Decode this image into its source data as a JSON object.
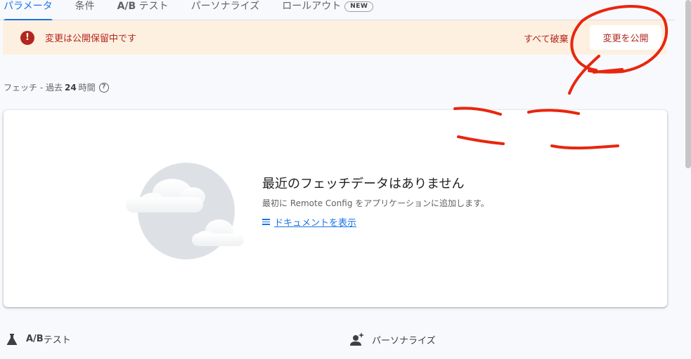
{
  "tabs": [
    {
      "label": "パラメータ"
    },
    {
      "label": "条件"
    },
    {
      "label_ab": "A/B",
      "label": " テスト"
    },
    {
      "label": "パーソナライズ"
    },
    {
      "label": "ロールアウト",
      "badge": "NEW"
    }
  ],
  "banner": {
    "icon": "!",
    "text": "変更は公開保留中です",
    "discard_label": "すべて破棄",
    "publish_label": "変更を公開"
  },
  "fetch": {
    "prefix": "フェッチ - 過去",
    "number": "24",
    "suffix": "時間",
    "help_icon": "?"
  },
  "empty_state": {
    "title": "最近のフェッチデータはありません",
    "description": "最初に Remote Config をアプリケーションに追加します。",
    "doc_link": "ドキュメントを表示"
  },
  "bottom": {
    "ab_bold": "A/B",
    "ab_label": " テスト",
    "personalize_label": "パーソナライズ"
  },
  "annotation": {
    "text": "ここ",
    "color": "#e8260e"
  },
  "colors": {
    "accent": "#1a73e8",
    "warning": "#b3261e",
    "banner_bg": "#fef0e0"
  }
}
